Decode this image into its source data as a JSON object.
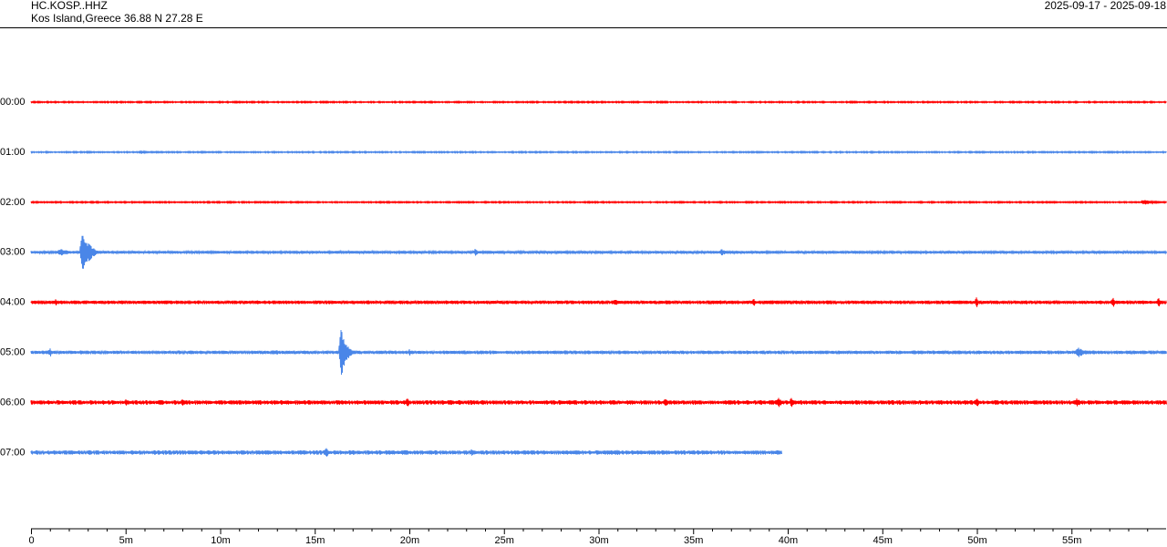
{
  "header": {
    "station": "HC.KOSP..HHZ",
    "location": "Kos Island,Greece  36.88 N 27.28 E",
    "date_range": "2025-09-17 - 2025-09-18"
  },
  "colors": {
    "even": "#ff0000",
    "odd": "#4a86e8",
    "axis": "#000000"
  },
  "chart_data": {
    "type": "line",
    "title": "",
    "xlabel": "",
    "ylabel": "",
    "xlim": [
      0,
      60
    ],
    "x_unit": "minutes",
    "x_tick_labels": [
      "0",
      "5m",
      "10m",
      "15m",
      "20m",
      "25m",
      "30m",
      "35m",
      "40m",
      "45m",
      "50m",
      "55m"
    ],
    "x_tick_values": [
      0,
      5,
      10,
      15,
      20,
      25,
      30,
      35,
      40,
      45,
      50,
      55
    ],
    "x_minor_step": 1,
    "rows": [
      {
        "label": "00:00",
        "color": "#ff0000",
        "end_minute": 60,
        "noise": 0.6,
        "events": []
      },
      {
        "label": "01:00",
        "color": "#4a86e8",
        "end_minute": 60,
        "noise": 0.6,
        "events": [
          {
            "t": 5.8,
            "amp": 3,
            "dur": 0.4
          }
        ]
      },
      {
        "label": "02:00",
        "color": "#ff0000",
        "end_minute": 60,
        "noise": 0.6,
        "events": [
          {
            "t": 58.8,
            "amp": 3,
            "dur": 1.2
          }
        ]
      },
      {
        "label": "03:00",
        "color": "#4a86e8",
        "end_minute": 60,
        "noise": 1.2,
        "events": [
          {
            "t": 2.7,
            "amp": 31,
            "dur": 0.7
          },
          {
            "t": 1.5,
            "amp": 4,
            "dur": 1.6
          },
          {
            "t": 23.5,
            "amp": 5,
            "dur": 0.2
          },
          {
            "t": 36.5,
            "amp": 4,
            "dur": 0.6
          }
        ]
      },
      {
        "label": "04:00",
        "color": "#ff0000",
        "end_minute": 60,
        "noise": 1.6,
        "events": [
          {
            "t": 1.3,
            "amp": 4,
            "dur": 0.2
          },
          {
            "t": 30.9,
            "amp": 4,
            "dur": 0.4
          },
          {
            "t": 38.2,
            "amp": 6,
            "dur": 0.1
          },
          {
            "t": 50.0,
            "amp": 7,
            "dur": 0.1
          },
          {
            "t": 57.2,
            "amp": 8,
            "dur": 0.1
          },
          {
            "t": 59.6,
            "amp": 5,
            "dur": 0.4
          }
        ]
      },
      {
        "label": "05:00",
        "color": "#4a86e8",
        "end_minute": 60,
        "noise": 1.6,
        "events": [
          {
            "t": 1.0,
            "amp": 6,
            "dur": 0.1
          },
          {
            "t": 13.0,
            "amp": 4,
            "dur": 0.1
          },
          {
            "t": 16.4,
            "amp": 29,
            "dur": 0.6
          },
          {
            "t": 20.0,
            "amp": 4,
            "dur": 0.2
          },
          {
            "t": 55.3,
            "amp": 6,
            "dur": 1.0
          }
        ]
      },
      {
        "label": "06:00",
        "color": "#ff0000",
        "end_minute": 60,
        "noise": 2.0,
        "events": [
          {
            "t": 5.0,
            "amp": 4,
            "dur": 0.4
          },
          {
            "t": 8.0,
            "amp": 4,
            "dur": 0.2
          },
          {
            "t": 19.9,
            "amp": 6,
            "dur": 0.2
          },
          {
            "t": 33.5,
            "amp": 5,
            "dur": 0.4
          },
          {
            "t": 39.5,
            "amp": 7,
            "dur": 0.3
          },
          {
            "t": 40.2,
            "amp": 6,
            "dur": 0.4
          },
          {
            "t": 50.0,
            "amp": 5,
            "dur": 0.3
          },
          {
            "t": 55.3,
            "amp": 5,
            "dur": 0.3
          }
        ]
      },
      {
        "label": "07:00",
        "color": "#4a86e8",
        "end_minute": 39.7,
        "noise": 2.0,
        "events": [
          {
            "t": 15.6,
            "amp": 6,
            "dur": 0.4
          },
          {
            "t": 23.3,
            "amp": 5,
            "dur": 0.4
          },
          {
            "t": 31.0,
            "amp": 3,
            "dur": 0.4
          }
        ]
      }
    ]
  }
}
